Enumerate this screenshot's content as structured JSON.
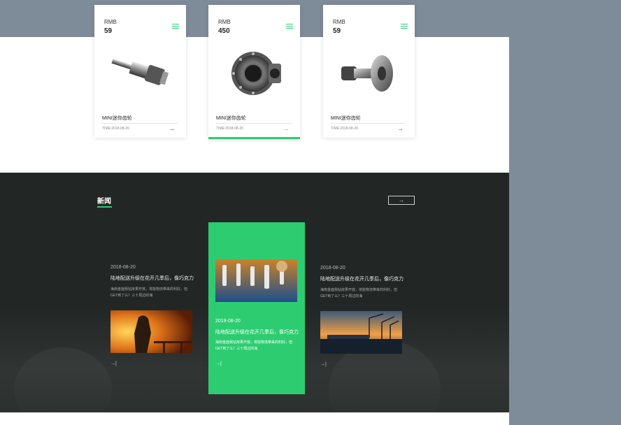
{
  "products": [
    {
      "currency": "RMB",
      "price": "59",
      "name": "MINI迷你齿轮",
      "time": "TIME:2018-08-20",
      "arrow": "→"
    },
    {
      "currency": "RMB",
      "price": "450",
      "name": "MINI迷你齿轮",
      "time": "TIME:2018-08-20",
      "arrow": "→"
    },
    {
      "currency": "RMB",
      "price": "59",
      "name": "MINI迷你齿轮",
      "time": "TIME:2018-08-20",
      "arrow": "→"
    }
  ],
  "news": {
    "title": "新闻",
    "more_arrow": "→",
    "items": [
      {
        "date": "2018-08-20",
        "headline": "陆地配送升级在花开几季后，像巧克力",
        "desc": "海南金面我钻房果开放，将能物流带来的利好，但GET到了么？三十周边的海",
        "arrow": "→|"
      },
      {
        "date": "2018-08-20",
        "headline": "陆地配送升级在花开几季后，像巧克力",
        "desc": "海南金面我钻房果开放，将能物流带来的利好，但GET到了么？三十周边的海",
        "arrow": "→|"
      },
      {
        "date": "2018-08-20",
        "headline": "陆地配送升级在花开几季后，像巧克力",
        "desc": "海南金面我钻房果开放，将能物流带来的利好，但GET到了么？三十周边的海",
        "arrow": "→|"
      }
    ]
  },
  "colors": {
    "accent": "#2ecc71",
    "dark": "#222726",
    "band": "#7e8b98"
  }
}
